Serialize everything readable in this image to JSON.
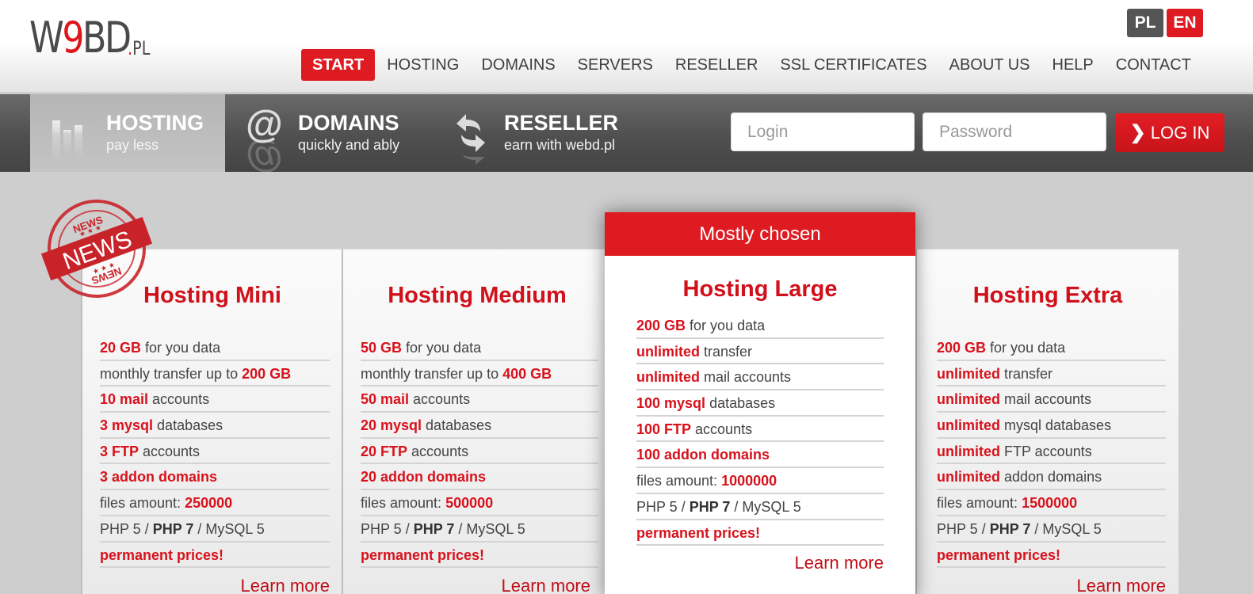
{
  "header": {
    "logo": {
      "main_a": "W",
      "main_red": "9",
      "main_b": "BD",
      "tld_dot": ".",
      "tld": "PL"
    },
    "languages": [
      {
        "code": "PL",
        "active": false
      },
      {
        "code": "EN",
        "active": true
      }
    ],
    "nav": [
      {
        "label": "START",
        "active": true
      },
      {
        "label": "HOSTING"
      },
      {
        "label": "DOMAINS"
      },
      {
        "label": "SERVERS"
      },
      {
        "label": "RESELLER"
      },
      {
        "label": "SSL CERTIFICATES"
      },
      {
        "label": "ABOUT US"
      },
      {
        "label": "HELP"
      },
      {
        "label": "CONTACT"
      }
    ]
  },
  "bar": {
    "tabs": [
      {
        "title": "HOSTING",
        "subtitle": "pay less",
        "icon": "bar-chart-icon",
        "active": true
      },
      {
        "title": "DOMAINS",
        "subtitle": "quickly and ably",
        "icon": "at-sign-icon"
      },
      {
        "title": "RESELLER",
        "subtitle": "earn with webd.pl",
        "icon": "exchange-arrows-icon"
      }
    ],
    "login": {
      "login_placeholder": "Login",
      "login_value": "",
      "password_placeholder": "Password",
      "password_value": "",
      "button_label": "LOG IN",
      "button_icon": "chevron-right-icon"
    }
  },
  "badge": {
    "top": "NEWS",
    "ribbon": "NEWS",
    "bottom": "NEWS"
  },
  "plans": [
    {
      "name": "Hosting Mini",
      "featured": false,
      "features": [
        [
          {
            "t": "20 GB",
            "s": "r"
          },
          {
            "t": " for you data"
          }
        ],
        [
          {
            "t": "monthly transfer up to "
          },
          {
            "t": "200 GB",
            "s": "r"
          }
        ],
        [
          {
            "t": "10 mail",
            "s": "r"
          },
          {
            "t": " accounts"
          }
        ],
        [
          {
            "t": "3 mysql",
            "s": "r"
          },
          {
            "t": " databases"
          }
        ],
        [
          {
            "t": "3 FTP",
            "s": "r"
          },
          {
            "t": " accounts"
          }
        ],
        [
          {
            "t": "3 addon domains",
            "s": "r"
          }
        ],
        [
          {
            "t": "files amount: "
          },
          {
            "t": "250000",
            "s": "r"
          }
        ],
        [
          {
            "t": "PHP 5 / "
          },
          {
            "t": "PHP 7",
            "s": "k"
          },
          {
            "t": " / MySQL 5"
          }
        ],
        [
          {
            "t": "permanent prices!",
            "s": "r"
          }
        ]
      ],
      "learn_more": "Learn more"
    },
    {
      "name": "Hosting Medium",
      "featured": false,
      "features": [
        [
          {
            "t": "50 GB",
            "s": "r"
          },
          {
            "t": " for you data"
          }
        ],
        [
          {
            "t": "monthly transfer up to "
          },
          {
            "t": "400 GB",
            "s": "r"
          }
        ],
        [
          {
            "t": "50 mail",
            "s": "r"
          },
          {
            "t": " accounts"
          }
        ],
        [
          {
            "t": "20 mysql",
            "s": "r"
          },
          {
            "t": " databases"
          }
        ],
        [
          {
            "t": "20 FTP",
            "s": "r"
          },
          {
            "t": " accounts"
          }
        ],
        [
          {
            "t": "20 addon domains",
            "s": "r"
          }
        ],
        [
          {
            "t": "files amount: "
          },
          {
            "t": "500000",
            "s": "r"
          }
        ],
        [
          {
            "t": "PHP 5 / "
          },
          {
            "t": "PHP 7",
            "s": "k"
          },
          {
            "t": " / MySQL 5"
          }
        ],
        [
          {
            "t": "permanent prices!",
            "s": "r"
          }
        ]
      ],
      "learn_more": "Learn more"
    },
    {
      "name": "Hosting Large",
      "featured": true,
      "banner": "Mostly chosen",
      "features": [
        [
          {
            "t": "200 GB",
            "s": "r"
          },
          {
            "t": " for you data"
          }
        ],
        [
          {
            "t": "unlimited",
            "s": "r"
          },
          {
            "t": " transfer"
          }
        ],
        [
          {
            "t": "unlimited",
            "s": "r"
          },
          {
            "t": " mail accounts"
          }
        ],
        [
          {
            "t": "100 mysql",
            "s": "r"
          },
          {
            "t": " databases"
          }
        ],
        [
          {
            "t": "100 FTP",
            "s": "r"
          },
          {
            "t": " accounts"
          }
        ],
        [
          {
            "t": "100 addon domains",
            "s": "r"
          }
        ],
        [
          {
            "t": "files amount: "
          },
          {
            "t": "1000000",
            "s": "r"
          }
        ],
        [
          {
            "t": "PHP 5 / "
          },
          {
            "t": "PHP 7",
            "s": "k"
          },
          {
            "t": " / MySQL 5"
          }
        ],
        [
          {
            "t": "permanent prices!",
            "s": "r"
          }
        ]
      ],
      "learn_more": "Learn more"
    },
    {
      "name": "Hosting Extra",
      "featured": false,
      "features": [
        [
          {
            "t": "200 GB",
            "s": "r"
          },
          {
            "t": " for you data"
          }
        ],
        [
          {
            "t": "unlimited",
            "s": "r"
          },
          {
            "t": " transfer"
          }
        ],
        [
          {
            "t": "unlimited",
            "s": "r"
          },
          {
            "t": " mail accounts"
          }
        ],
        [
          {
            "t": "unlimited",
            "s": "r"
          },
          {
            "t": " mysql databases"
          }
        ],
        [
          {
            "t": "unlimited",
            "s": "r"
          },
          {
            "t": " FTP accounts"
          }
        ],
        [
          {
            "t": "unlimited",
            "s": "r"
          },
          {
            "t": " addon domains"
          }
        ],
        [
          {
            "t": "files amount: "
          },
          {
            "t": "1500000",
            "s": "r"
          }
        ],
        [
          {
            "t": "PHP 5 / "
          },
          {
            "t": "PHP 7",
            "s": "k"
          },
          {
            "t": " / MySQL 5"
          }
        ],
        [
          {
            "t": "permanent prices!",
            "s": "r"
          }
        ]
      ],
      "learn_more": "Learn more"
    }
  ],
  "colors": {
    "accent": "#df1b22",
    "title_red": "#d0101a",
    "dark_bar": "#505050",
    "text": "#444444"
  }
}
